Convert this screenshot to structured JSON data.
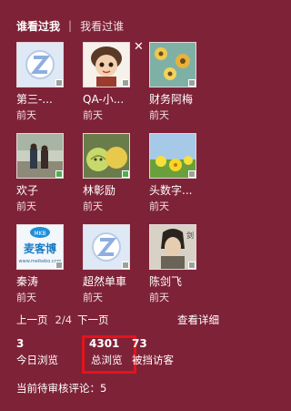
{
  "tabs": {
    "active": "谁看过我",
    "separator": "|",
    "other": "我看过谁"
  },
  "visitors": [
    {
      "name": "第三-...",
      "time": "前天",
      "avatar": "default-z-avatar",
      "online": false
    },
    {
      "name": "QA-小...",
      "time": "前天",
      "avatar": "cartoon-girl-avatar",
      "online": false
    },
    {
      "name": "财务阿梅",
      "time": "前天",
      "avatar": "flowers-avatar",
      "online": false
    },
    {
      "name": "欢子",
      "time": "前天",
      "avatar": "street-photo-avatar",
      "online": true
    },
    {
      "name": "林彰励",
      "time": "前天",
      "avatar": "melons-avatar",
      "online": true
    },
    {
      "name": "头数字...",
      "time": "前天",
      "avatar": "yellow-flowers-avatar",
      "online": false
    },
    {
      "name": "秦涛",
      "time": "前天",
      "avatar": "maikeibo-logo-avatar",
      "online": false
    },
    {
      "name": "超然单車",
      "time": "前天",
      "avatar": "default-z-avatar",
      "online": false
    },
    {
      "name": "陈剑飞",
      "time": "前天",
      "avatar": "actor-poster-avatar",
      "online": false
    }
  ],
  "logo_text": {
    "cn": "麦客博",
    "en": "www.meikebo.com",
    "badge": "MKB"
  },
  "pager": {
    "prev": "上一页",
    "current": "2/4",
    "next": "下一页",
    "detail": "查看详细"
  },
  "stats": {
    "today_count": "3",
    "today_label": "今日浏览",
    "total_count": "4301",
    "total_label": "总浏览",
    "blocked_count": "73",
    "blocked_label": "被挡访客"
  },
  "pending": "当前待审核评论：5",
  "colors": {
    "background": "#7e2237",
    "highlight": "#e5131a"
  }
}
